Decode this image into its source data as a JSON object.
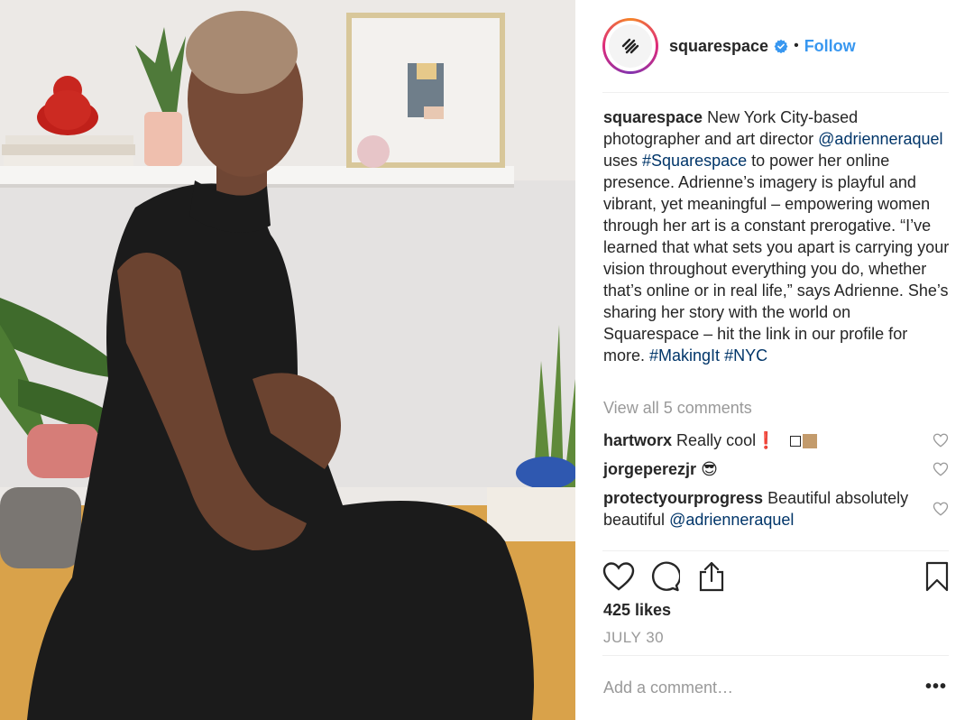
{
  "post": {
    "username": "squarespace",
    "follow_label": "Follow",
    "separator": "•",
    "caption": {
      "user": "squarespace",
      "text_1": " New York City-based photographer and art director ",
      "mention_1": "@adrienneraquel",
      "text_2": " uses ",
      "hashtag_1": "#Squarespace",
      "text_3": " to power her online presence. Adrienne’s imagery is playful and vibrant, yet meaningful – empowering women through her art is a constant prerogative. “I’ve learned that what sets you apart is carrying your vision throughout everything you do, whether that’s online or in real life,” says Adrienne. She’s sharing her story with the world on Squarespace – hit the link in our profile for more. ",
      "hashtag_2": "#MakingIt",
      "hashtag_3": "#NYC"
    },
    "view_all_comments": "View all 5 comments",
    "comments": [
      {
        "user": "hartworx",
        "text": "Really cool",
        "emoji": "❗"
      },
      {
        "user": "jorgeperezjr",
        "text": "",
        "emoji": "😎"
      },
      {
        "user": "protectyourprogress",
        "text": "Beautiful absolutely beautiful ",
        "mention": "@adrienneraquel"
      }
    ],
    "likes": "425 likes",
    "date": "JULY 30",
    "add_comment_placeholder": "Add a comment…",
    "more_label": "•••"
  },
  "colors": {
    "link": "#003569",
    "follow": "#3897f0",
    "muted": "#999999",
    "verified": "#3897f0"
  },
  "icons": [
    "squarespace-logo-icon",
    "verified-badge-icon",
    "heart-icon",
    "comment-icon",
    "share-icon",
    "bookmark-icon"
  ]
}
